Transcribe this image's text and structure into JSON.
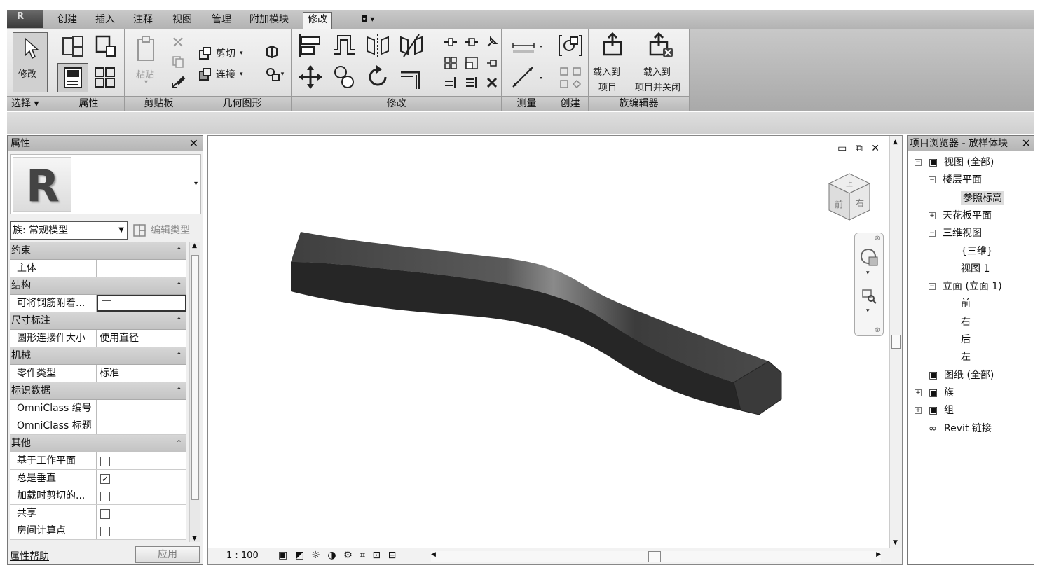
{
  "app": {
    "button_glyph": "R"
  },
  "tabs": [
    "创建",
    "插入",
    "注释",
    "视图",
    "管理",
    "附加模块",
    "修改"
  ],
  "tab_extra": "◘ ▾",
  "ribbon": {
    "panels": {
      "select": "选择 ▾",
      "properties": "属性",
      "clipboard": "剪贴板",
      "geometry": "几何图形",
      "modify": "修改",
      "measure": "测量",
      "create": "创建",
      "family_editor": "族编辑器"
    },
    "modify_label": "修改",
    "paste_label": "粘贴",
    "cut_label": "剪切",
    "join_label": "连接",
    "load_into_project": [
      "载入到",
      "项目"
    ],
    "load_close": [
      "载入到",
      "项目并关闭"
    ]
  },
  "properties": {
    "title": "属性",
    "close": "✕",
    "family_select": "族: 常规模型",
    "edit_type": "编辑类型",
    "groups": [
      {
        "name": "约束",
        "rows": [
          {
            "name": "主体",
            "value": ""
          }
        ]
      },
      {
        "name": "结构",
        "rows": [
          {
            "name": "可将钢筋附着...",
            "check": false,
            "edit": true
          }
        ]
      },
      {
        "name": "尺寸标注",
        "rows": [
          {
            "name": "圆形连接件大小",
            "value": "使用直径"
          }
        ]
      },
      {
        "name": "机械",
        "rows": [
          {
            "name": "零件类型",
            "value": "标准"
          }
        ]
      },
      {
        "name": "标识数据",
        "rows": [
          {
            "name": "OmniClass 编号",
            "value": ""
          },
          {
            "name": "OmniClass 标题",
            "value": ""
          }
        ]
      },
      {
        "name": "其他",
        "rows": [
          {
            "name": "基于工作平面",
            "check": false
          },
          {
            "name": "总是垂直",
            "check": true
          },
          {
            "name": "加载时剪切的...",
            "check": false
          },
          {
            "name": "共享",
            "check": false
          },
          {
            "name": "房间计算点",
            "check": false
          }
        ]
      }
    ],
    "help_link": "属性帮助",
    "apply": "应用"
  },
  "view": {
    "window_controls": "▭ ⧉ ✕",
    "scale": "1 : 100",
    "viewcube_faces": {
      "top": "上",
      "front": "前",
      "right": "右"
    },
    "model_color": "#3c3c3c"
  },
  "browser": {
    "title": "项目浏览器 - 放样体块",
    "close": "✕",
    "nodes": [
      {
        "label": "视图 (全部)",
        "level": 0,
        "box": "−",
        "icon": "views-icon"
      },
      {
        "label": "楼层平面",
        "level": 1,
        "box": "−"
      },
      {
        "label": "参照标高",
        "level": 2,
        "selected": true
      },
      {
        "label": "天花板平面",
        "level": 1,
        "box": "+"
      },
      {
        "label": "三维视图",
        "level": 1,
        "box": "−"
      },
      {
        "label": "{三维}",
        "level": 2
      },
      {
        "label": "视图 1",
        "level": 2
      },
      {
        "label": "立面 (立面 1)",
        "level": 1,
        "box": "−"
      },
      {
        "label": "前",
        "level": 2
      },
      {
        "label": "右",
        "level": 2
      },
      {
        "label": "后",
        "level": 2
      },
      {
        "label": "左",
        "level": 2
      },
      {
        "label": "图纸 (全部)",
        "level": 0,
        "icon": "sheets-icon"
      },
      {
        "label": "族",
        "level": 0,
        "box": "+",
        "icon": "families-icon"
      },
      {
        "label": "组",
        "level": 0,
        "box": "+",
        "icon": "groups-icon"
      },
      {
        "label": "Revit 链接",
        "level": 0,
        "icon": "links-icon"
      }
    ]
  }
}
